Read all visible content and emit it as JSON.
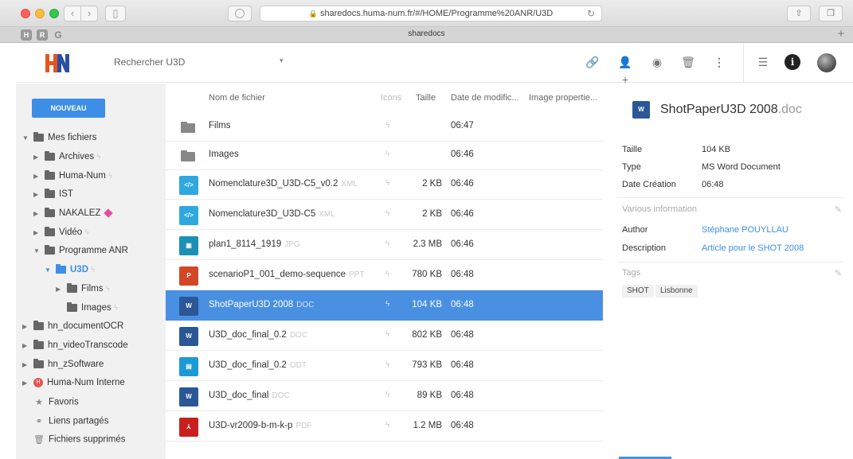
{
  "browser": {
    "url_text": "sharedocs.huma-num.fr/#/HOME/Programme%20ANR/U3D",
    "tab_title": "sharedocs",
    "favorites": [
      "H",
      "R",
      "G"
    ]
  },
  "header": {
    "search_placeholder": "Rechercher U3D"
  },
  "sidebar": {
    "new_button": "NOUVEAU",
    "tree": [
      {
        "label": "Mes fichiers"
      },
      {
        "label": "Archives"
      },
      {
        "label": "Huma-Num"
      },
      {
        "label": "IST"
      },
      {
        "label": "NAKALEZ"
      },
      {
        "label": "Vidéo"
      },
      {
        "label": "Programme ANR"
      },
      {
        "label": "U3D"
      },
      {
        "label": "Films"
      },
      {
        "label": "Images"
      },
      {
        "label": "hn_documentOCR"
      },
      {
        "label": "hn_videoTranscode"
      },
      {
        "label": "hn_zSoftware"
      },
      {
        "label": "Huma-Num Interne"
      },
      {
        "label": "Favoris"
      },
      {
        "label": "Liens partagés"
      },
      {
        "label": "Fichiers supprimés"
      }
    ]
  },
  "list": {
    "columns": {
      "name": "Nom de fichier",
      "icons": "Icons",
      "size": "Taille",
      "date": "Date de modific...",
      "image": "Image propertie..."
    },
    "rows": [
      {
        "name": "Films",
        "ext": "",
        "size": "",
        "date": "06:47",
        "icon": "folder-icon",
        "badge": ""
      },
      {
        "name": "Images",
        "ext": "",
        "size": "",
        "date": "06:46",
        "icon": "folder-icon",
        "badge": ""
      },
      {
        "name": "Nomenclature3D_U3D-C5_v0.2",
        "ext": "XML",
        "size": "2 KB",
        "date": "06:46",
        "icon": "xml-file-icon",
        "badge": "</>"
      },
      {
        "name": "Nomenclature3D_U3D-C5",
        "ext": "XML",
        "size": "2 KB",
        "date": "06:46",
        "icon": "xml-file-icon",
        "badge": "</>"
      },
      {
        "name": "plan1_8114_1919",
        "ext": "JPG",
        "size": "2.3 MB",
        "date": "06:46",
        "icon": "image-file-icon",
        "badge": "▣"
      },
      {
        "name": "scenarioP1_001_demo-sequence",
        "ext": "PPT",
        "size": "780 KB",
        "date": "06:48",
        "icon": "powerpoint-file-icon",
        "badge": "P"
      },
      {
        "name": "ShotPaperU3D 2008",
        "ext": "DOC",
        "size": "104 KB",
        "date": "06:48",
        "icon": "word-file-icon",
        "badge": "W"
      },
      {
        "name": "U3D_doc_final_0.2",
        "ext": "DOC",
        "size": "802 KB",
        "date": "06:48",
        "icon": "word-file-icon",
        "badge": "W"
      },
      {
        "name": "U3D_doc_final_0.2",
        "ext": "ODT",
        "size": "793 KB",
        "date": "06:48",
        "icon": "odt-file-icon",
        "badge": "▤"
      },
      {
        "name": "U3D_doc_final",
        "ext": "DOC",
        "size": "89 KB",
        "date": "06:48",
        "icon": "word-file-icon",
        "badge": "W"
      },
      {
        "name": "U3D-vr2009-b-m-k-p",
        "ext": "PDF",
        "size": "1.2 MB",
        "date": "06:48",
        "icon": "pdf-file-icon",
        "badge": "⅄"
      }
    ],
    "selected_index": 6
  },
  "detail": {
    "title_name": "ShotPaperU3D 2008",
    "title_ext": ".doc",
    "props": [
      {
        "key": "Taille",
        "value": "104 KB"
      },
      {
        "key": "Type",
        "value": "MS Word Document"
      },
      {
        "key": "Date Création",
        "value": "06:48"
      }
    ],
    "various_label": "Various information",
    "meta": [
      {
        "key": "Author",
        "value": "Stéphane POUYLLAU"
      },
      {
        "key": "Description",
        "value": "Article pour le SHOT 2008"
      }
    ],
    "tags_label": "Tags",
    "tags": [
      "SHOT",
      "Lisbonne"
    ]
  },
  "colors": {
    "accent": "#4a90e2",
    "new_button": "#3d8ee6",
    "word": "#2b5797",
    "powerpoint": "#d24726",
    "pdf": "#c8201e",
    "xml": "#2ea8df",
    "image": "#1b8fb6",
    "odt": "#1b9ad6"
  }
}
